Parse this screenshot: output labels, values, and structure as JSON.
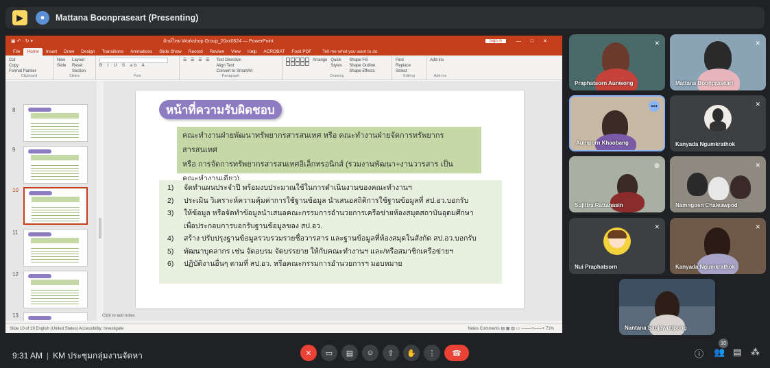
{
  "topbar": {
    "presenter_title": "Mattana Boonpraseart (Presenting)"
  },
  "ppt": {
    "quick_access": "▣ ↶ · ↻ ▾",
    "file_name": "ยักษ์ไทย Workshop Group_20xx0624 — PowerPoint",
    "sign_in": "Sign in",
    "tabs": [
      "File",
      "Home",
      "Insert",
      "Draw",
      "Design",
      "Transitions",
      "Animations",
      "Slide Show",
      "Record",
      "Review",
      "View",
      "Help",
      "ACROBAT",
      "Foxit PDF"
    ],
    "tell_me": "Tell me what you want to do",
    "ribbon": {
      "clipboard": [
        "Cut",
        "Copy",
        "Format Painter"
      ],
      "clipboard_label": "Clipboard",
      "slides": [
        "Layout",
        "Reset",
        "Section"
      ],
      "new_slide": "New Slide",
      "slides_label": "Slides",
      "font_label": "Font",
      "paragraph": [
        "Text Direction",
        "Align Text",
        "Convert to SmartArt"
      ],
      "paragraph_label": "Paragraph",
      "drawing": [
        "Shape Fill",
        "Shape Outline",
        "Shape Effects"
      ],
      "arrange": "Arrange",
      "quick_styles": "Quick Styles",
      "drawing_label": "Drawing",
      "editing": [
        "Find",
        "Replace",
        "Select"
      ],
      "editing_label": "Editing",
      "addins": "Add-ins",
      "addins_label": "Add-ins"
    },
    "thumb_numbers": [
      "8",
      "9",
      "10",
      "11",
      "12",
      "13"
    ],
    "notes_placeholder": "Click to add notes",
    "status_left": "Slide 10 of 19   English (United States)   Accessibility: Investigate",
    "status_right": "Notes   Comments   ▤ ▦ ▥ ▭   −——+——+ 71%"
  },
  "slide": {
    "title": "หน้าที่ความรับผิดชอบ",
    "intro": [
      "คณะทำงานฝ่ายพัฒนาทรัพยากรสารสนเทศ หรือ คณะทำงานฝ่ายจัดการทรัพยากรสารสนเทศ",
      "หรือ การจัดการทรัพยากรสารสนเทศอิเล็กทรอนิกส์ (รวมงานพัฒนา+งานวารสาร เป็น",
      "คณะทำงานเดียว)"
    ],
    "items": [
      {
        "num": "1)",
        "text": "จัดทำแผนประจำปี พร้อมงบประมาณใช้ในการดำเนินงานของคณะทำงานฯ"
      },
      {
        "num": "2)",
        "text": "ประเมิน วิเคราะห์ความคุ้มค่าการใช้ฐานข้อมูล นำเสนอสถิติการใช้ฐานข้อมูลที่ สป.อว.บอกรับ"
      },
      {
        "num": "3)",
        "text": "ให้ข้อมูล หรือจัดทำข้อมูลนำเสนอคณะกรรมการอำนวยการเครือข่ายห้องสมุดสถาบันอุดมศึกษา"
      },
      {
        "num": "",
        "text": "เพื่อประกอบการบอกรับฐานข้อมูลของ สป.อว."
      },
      {
        "num": "4)",
        "text": "สร้าง ปรับปรุงฐานข้อมูลรวบรวมรายชื่อวารสาร และฐานข้อมูลที่ห้องสมุดในสังกัด สป.อว.บอกรับ"
      },
      {
        "num": "5)",
        "text": "พัฒนาบุคลากร เช่น จัดอบรม จัดบรรยาย ให้กับคณะทำงานฯ และ/หรือสมาชิกเครือข่ายฯ"
      },
      {
        "num": "6)",
        "text": "ปฏิบัติงานอื่นๆ ตามที่ สป.อว. หรือคณะกรรมการอำนวยการฯ มอบหมาย"
      }
    ]
  },
  "participants": [
    {
      "name": "Praphatsorn Aunwong",
      "muted": true
    },
    {
      "name": "Mattana Boonpraseart",
      "muted": true
    },
    {
      "name": "Aumporn Khaobang",
      "muted": false,
      "active": true
    },
    {
      "name": "Kanyada Ngumkrathok",
      "muted": true
    },
    {
      "name": "Sujittra Rattanasin",
      "muted": false
    },
    {
      "name": "Namngoen Chaleawpod",
      "muted": true
    },
    {
      "name": "Nui Praphatsorn",
      "muted": true
    },
    {
      "name": "Kanyada Ngumkrathok",
      "muted": true
    },
    {
      "name": "Nantana Saojawutipong",
      "muted": false
    }
  ],
  "bottom": {
    "time": "9:31 AM",
    "meeting_title": "KM ประชุมกลุ่มงานจัดหา",
    "participant_count": "10"
  },
  "colors": {
    "meet_red": "#ea4335",
    "ppt_red": "#c43e1c",
    "slide_purple": "#8e7cc3",
    "slide_green": "#c5d9a8"
  }
}
